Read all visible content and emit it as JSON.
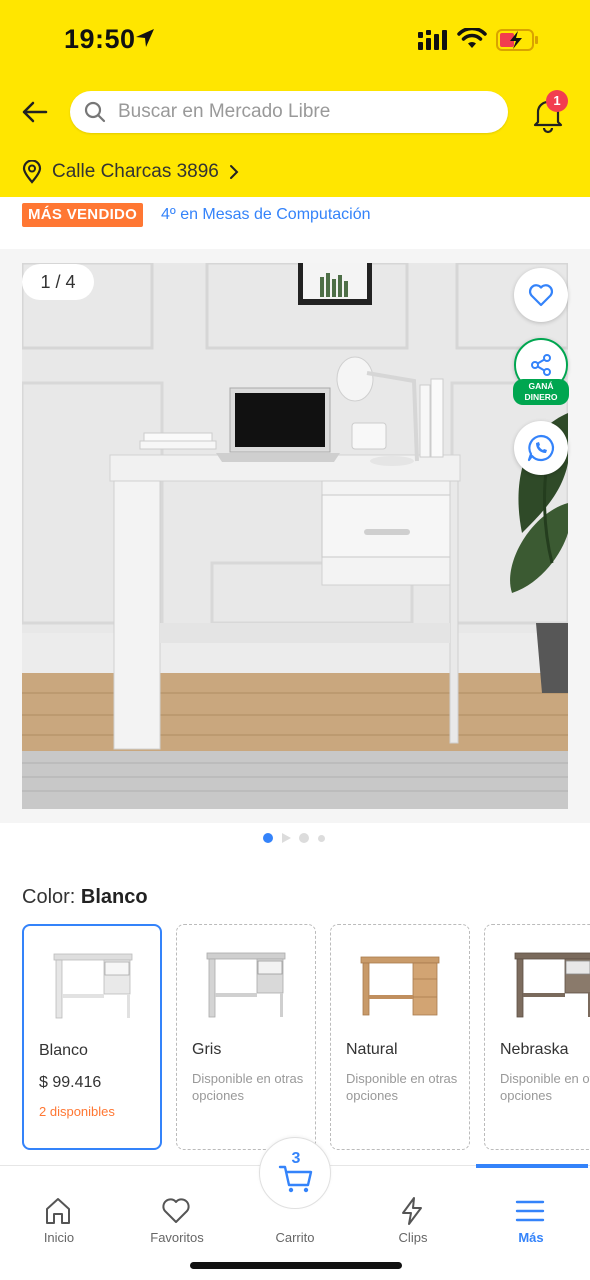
{
  "status_bar": {
    "time": "19:50"
  },
  "header": {
    "search_placeholder": "Buscar en Mercado Libre",
    "notifications_count": "1",
    "address": "Calle Charcas 3896",
    "accent_color": "#FFE600"
  },
  "product": {
    "badge": "MÁS VENDIDO",
    "ranking": "4º en Mesas de Computación",
    "image_counter": "1 / 4",
    "earn_label_line1": "GANÁ",
    "earn_label_line2": "DINERO",
    "color_label": "Color:",
    "color_value": "Blanco",
    "variants": [
      {
        "name": "Blanco",
        "price": "$ 99.416",
        "stock": "2 disponibles"
      },
      {
        "name": "Gris",
        "note": "Disponible en otras opciones"
      },
      {
        "name": "Natural",
        "note": "Disponible en otras opciones"
      },
      {
        "name": "Nebraska",
        "note": "Disponible en otras opciones"
      }
    ]
  },
  "bottom_nav": {
    "items": [
      {
        "label": "Inicio",
        "icon": "home-icon"
      },
      {
        "label": "Favoritos",
        "icon": "heart-icon"
      },
      {
        "label": "Carrito",
        "icon": "cart-icon"
      },
      {
        "label": "Clips",
        "icon": "bolt-icon"
      },
      {
        "label": "Más",
        "icon": "menu-icon"
      }
    ],
    "cart_count": "3",
    "active_color": "#3483FA"
  }
}
